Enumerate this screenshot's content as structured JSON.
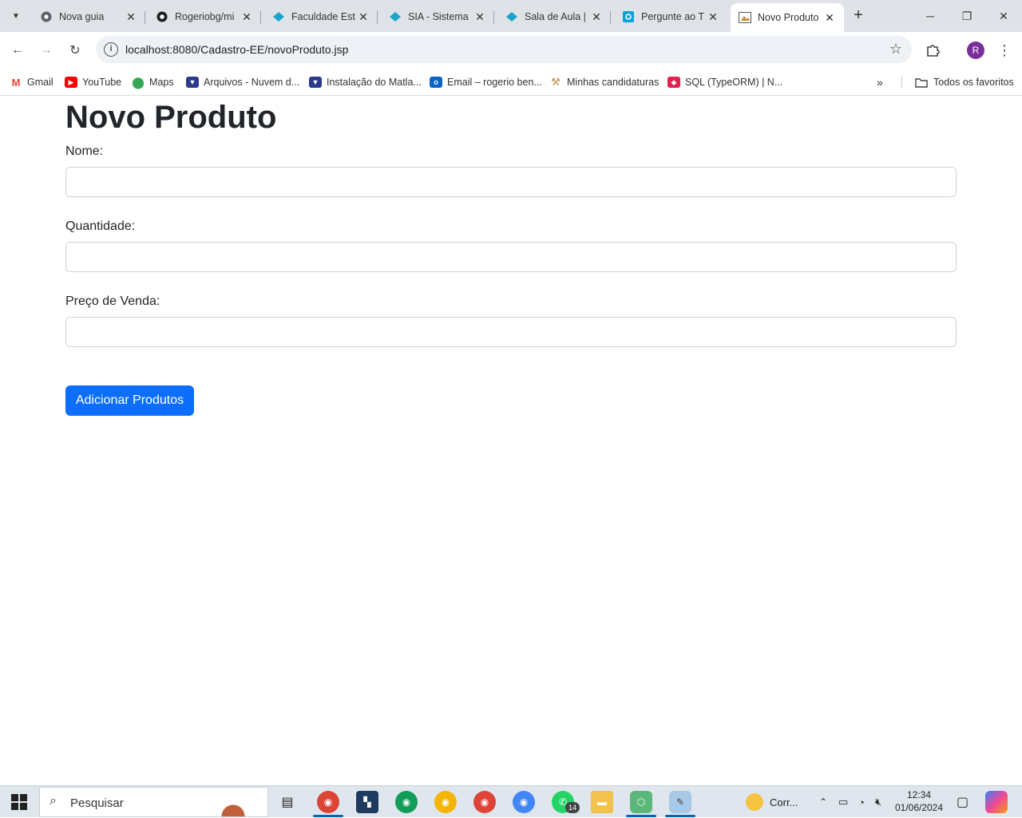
{
  "browser": {
    "tabs": [
      {
        "title": "Nova guia",
        "icon": "chrome-icon"
      },
      {
        "title": "Rogeriobg/mi",
        "icon": "github-icon"
      },
      {
        "title": "Faculdade Est",
        "icon": "estacio-icon"
      },
      {
        "title": "SIA - Sistema",
        "icon": "estacio-icon"
      },
      {
        "title": "Sala de Aula |",
        "icon": "estacio-icon"
      },
      {
        "title": "Pergunte ao T",
        "icon": "outlook-icon"
      },
      {
        "title": "Novo Produto",
        "icon": "page-icon",
        "active": true
      }
    ],
    "url": "localhost:8080/Cadastro-EE/novoProduto.jsp",
    "profile_initial": "R",
    "bookmarks": [
      {
        "label": "Gmail",
        "icon": "gmail-icon"
      },
      {
        "label": "YouTube",
        "icon": "youtube-icon"
      },
      {
        "label": "Maps",
        "icon": "maps-icon"
      },
      {
        "label": "Arquivos - Nuvem d...",
        "icon": "shield-icon"
      },
      {
        "label": "Instalação do Matla...",
        "icon": "shield-icon"
      },
      {
        "label": "Email – rogerio ben...",
        "icon": "outlook-icon"
      },
      {
        "label": "Minhas candidaturas",
        "icon": "hammer-icon"
      },
      {
        "label": "SQL (TypeORM) | N...",
        "icon": "nest-icon"
      }
    ],
    "all_bookmarks_label": "Todos os favoritos"
  },
  "page": {
    "title": "Novo Produto",
    "fields": {
      "nome_label": "Nome:",
      "nome_value": "",
      "quantidade_label": "Quantidade:",
      "quantidade_value": "",
      "preco_label": "Preço de Venda:",
      "preco_value": ""
    },
    "submit_label": "Adicionar Produtos"
  },
  "taskbar": {
    "search_placeholder": "Pesquisar",
    "weather_label": "Corr...",
    "time": "12:34",
    "date": "01/06/2024",
    "whatsapp_badge": "14"
  },
  "colors": {
    "primary_button": "#0d6efd",
    "tabstrip_bg": "#dfe3e8",
    "profile_avatar": "#7b2d9c"
  }
}
